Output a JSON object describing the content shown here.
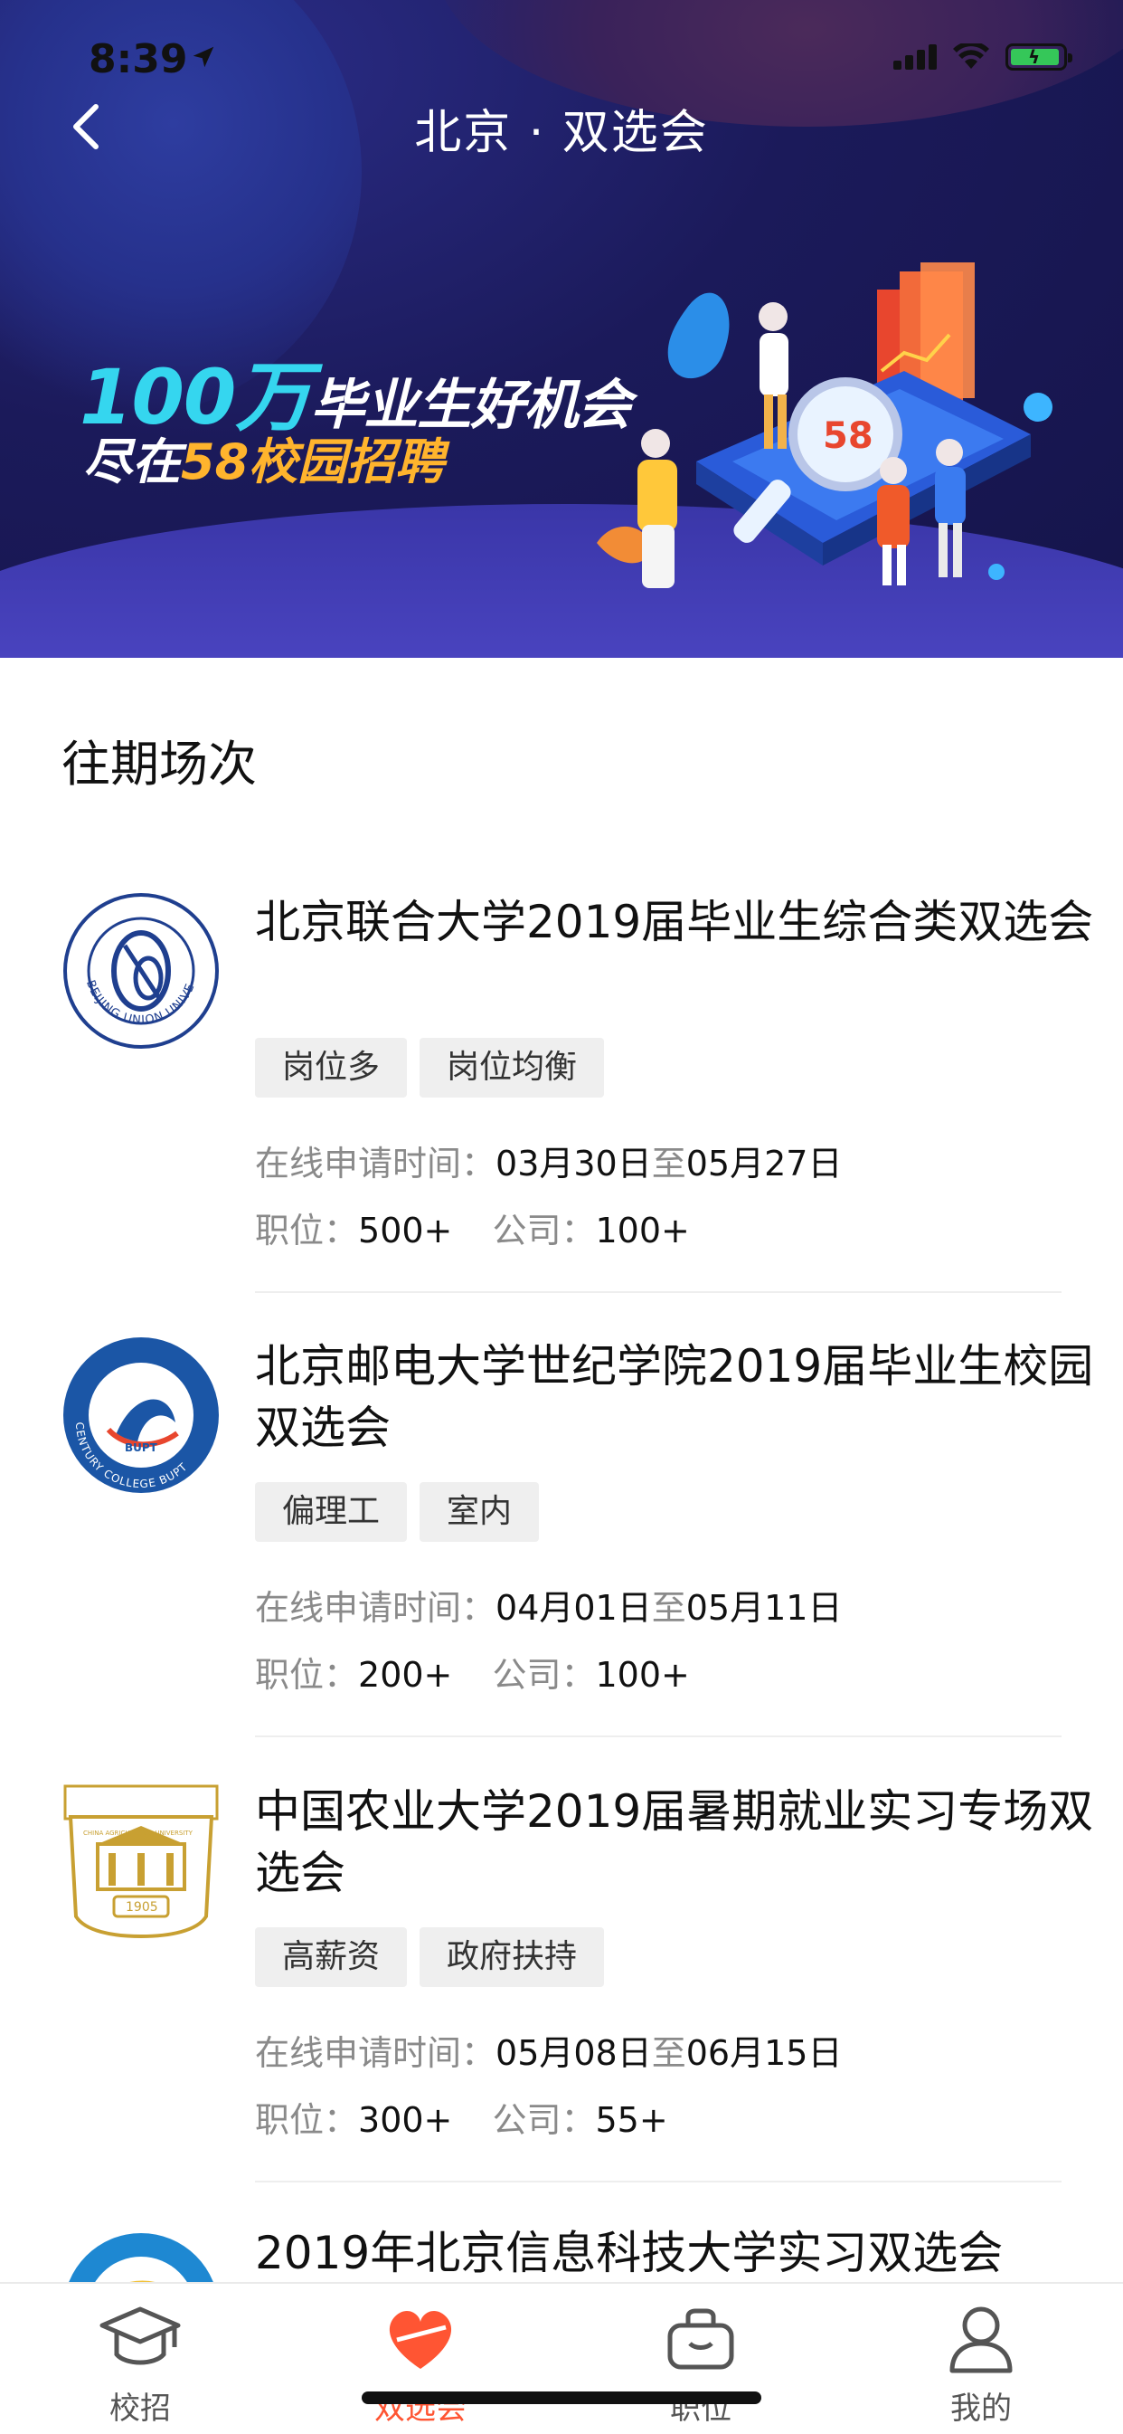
{
  "status_bar": {
    "time": "8:39"
  },
  "nav": {
    "title": "北京 · 双选会"
  },
  "banner": {
    "line1_big": "100万",
    "line1_small": "毕业生好机会",
    "line2_prefix": "尽在",
    "line2_highlight": "58校园招聘",
    "illustration_text": "58"
  },
  "section_title": "往期场次",
  "events": [
    {
      "title": "北京联合大学2019届毕业生综合类双选会",
      "tags": [
        "岗位多",
        "岗位均衡"
      ],
      "apply_label": "在线申请时间：",
      "start": "03月30日",
      "to": "至",
      "end": "05月27日",
      "positions_label": "职位：",
      "positions": "500+",
      "companies_label": "公司：",
      "companies": "100+",
      "logo_color": "#1f3f8f",
      "logo_text": "BEIJING UNION UNIVERSITY"
    },
    {
      "title": "北京邮电大学世纪学院2019届毕业生校园双选会",
      "tags": [
        "偏理工",
        "室内"
      ],
      "apply_label": "在线申请时间：",
      "start": "04月01日",
      "to": "至",
      "end": "05月11日",
      "positions_label": "职位：",
      "positions": "200+",
      "companies_label": "公司：",
      "companies": "100+",
      "logo_color": "#1b56a6",
      "logo_text": "CENTURY COLLEGE BUPT"
    },
    {
      "title": "中国农业大学2019届暑期就业实习专场双选会",
      "tags": [
        "高薪资",
        "政府扶持"
      ],
      "apply_label": "在线申请时间：",
      "start": "05月08日",
      "to": "至",
      "end": "06月15日",
      "positions_label": "职位：",
      "positions": "300+",
      "companies_label": "公司：",
      "companies": "55+",
      "logo_color": "#c8a032",
      "logo_text": "CHINA AGRICULTURAL UNIVERSITY",
      "logo_year": "1905"
    },
    {
      "title": "2019年北京信息科技大学实习双选会",
      "logo_color": "#1e88d2"
    }
  ],
  "tabbar": {
    "tabs": [
      {
        "label": "校招",
        "icon": "graduation-cap-icon",
        "active": false
      },
      {
        "label": "双选会",
        "icon": "heart-icon",
        "active": true
      },
      {
        "label": "职位",
        "icon": "briefcase-icon",
        "active": false
      },
      {
        "label": "我的",
        "icon": "person-icon",
        "active": false
      }
    ],
    "active_color": "#ff5533"
  }
}
